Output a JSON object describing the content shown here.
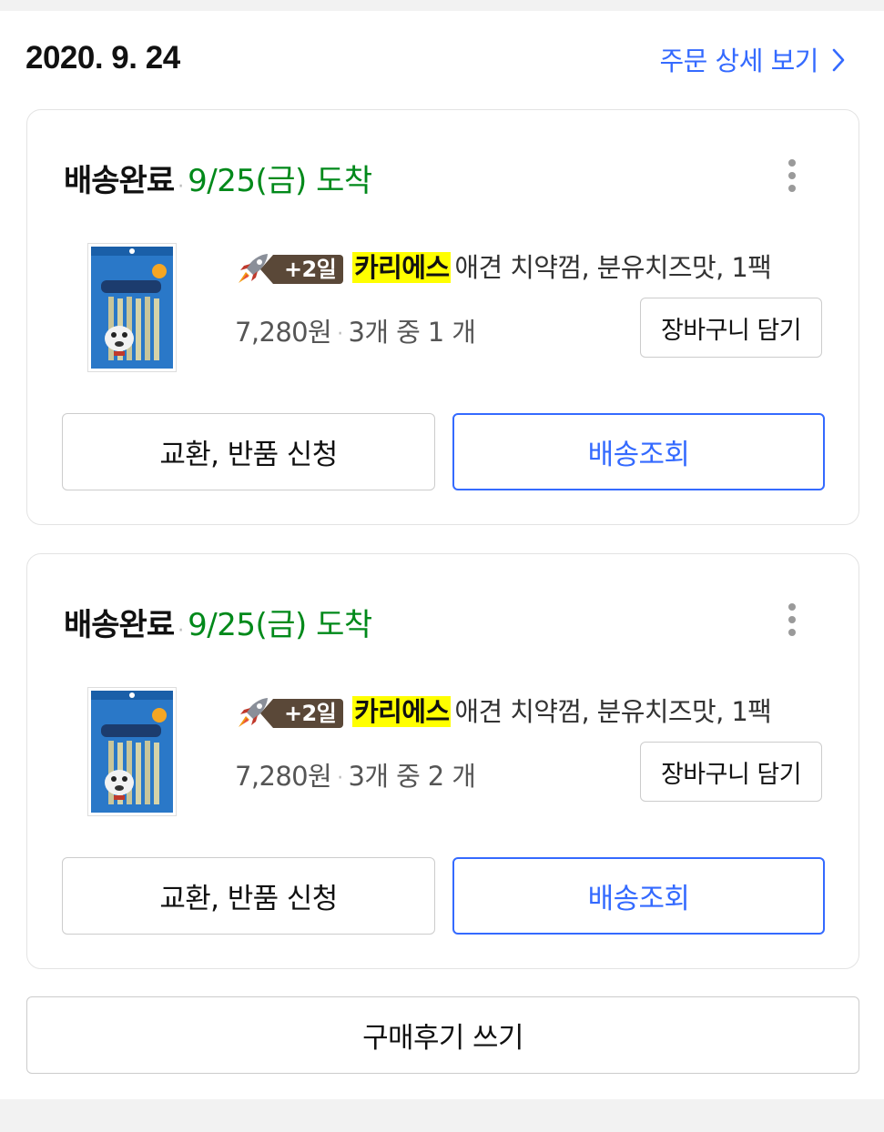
{
  "order": {
    "date": "2020. 9. 24",
    "detail_link": "주문 상세 보기"
  },
  "items": [
    {
      "status": "배송완료",
      "arrival": "9/25(금) 도착",
      "badge": "+2일",
      "brand": "카리에스",
      "name": "애견 치약껌, 분유치즈맛, 1팩",
      "price": "7,280원",
      "qty": "3개 중 1 개",
      "cart_label": "장바구니 담기",
      "return_label": "교환, 반품 신청",
      "track_label": "배송조회"
    },
    {
      "status": "배송완료",
      "arrival": "9/25(금) 도착",
      "badge": "+2일",
      "brand": "카리에스",
      "name": "애견 치약껌, 분유치즈맛, 1팩",
      "price": "7,280원",
      "qty": "3개 중 2 개",
      "cart_label": "장바구니 담기",
      "return_label": "교환, 반품 신청",
      "track_label": "배송조회"
    }
  ],
  "review_label": "구매후기 쓰기",
  "colors": {
    "accent_blue": "#346aff",
    "arrival_green": "#00891a",
    "brand_highlight": "#ffff00",
    "badge_brown": "#5a4838"
  },
  "icons": [
    "chevron-right-icon",
    "more-vertical-icon",
    "rocket-icon"
  ]
}
